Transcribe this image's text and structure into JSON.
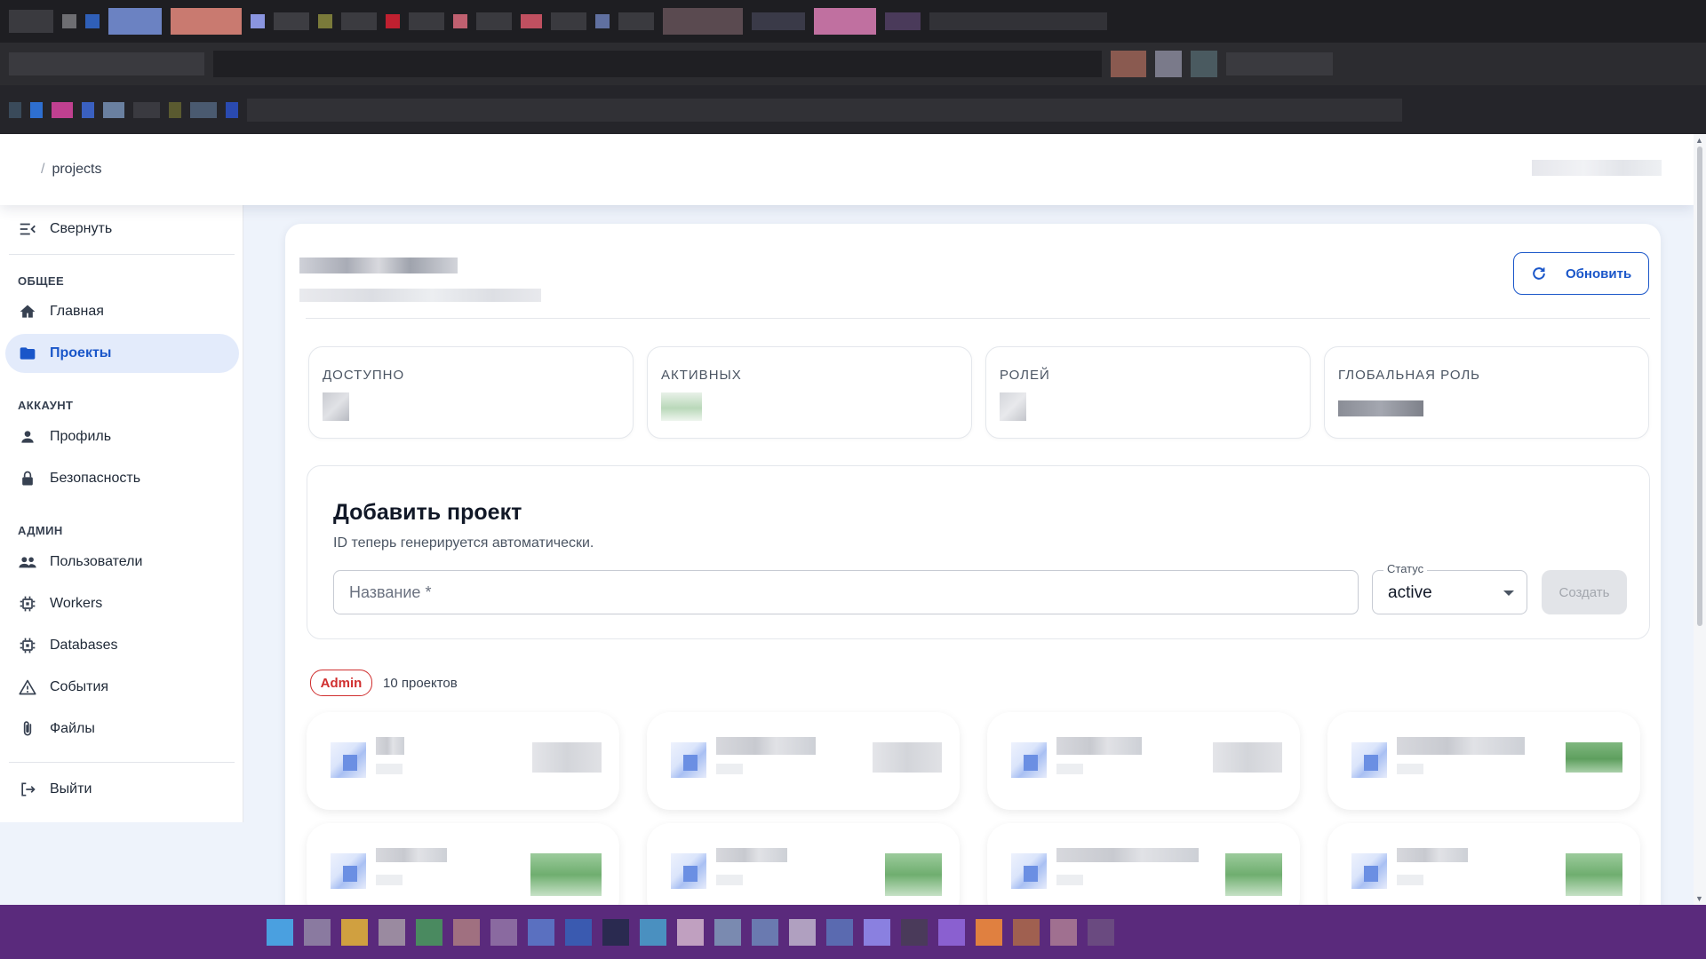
{
  "breadcrumb": {
    "separator": "/",
    "current": "projects"
  },
  "sidebar": {
    "collapse": {
      "label": "Свернуть",
      "icon": "collapse-menu-icon"
    },
    "sections": [
      {
        "title": "ОБЩЕЕ"
      },
      {
        "title": "АККАУНТ"
      },
      {
        "title": "АДМИН"
      }
    ],
    "items": [
      {
        "label": "Главная",
        "icon": "home-icon"
      },
      {
        "label": "Проекты",
        "icon": "folder-icon",
        "active": true
      },
      {
        "label": "Профиль",
        "icon": "person-icon"
      },
      {
        "label": "Безопасность",
        "icon": "lock-icon"
      },
      {
        "label": "Пользователи",
        "icon": "people-icon"
      },
      {
        "label": "Workers",
        "icon": "chip-icon"
      },
      {
        "label": "Databases",
        "icon": "chip-icon"
      },
      {
        "label": "События",
        "icon": "warning-icon"
      },
      {
        "label": "Файлы",
        "icon": "paperclip-icon"
      }
    ],
    "logout": {
      "label": "Выйти",
      "icon": "logout-icon"
    }
  },
  "header": {
    "refresh_label": "Обновить"
  },
  "stats": [
    {
      "label": "ДОСТУПНО"
    },
    {
      "label": "АКТИВНЫХ"
    },
    {
      "label": "РОЛЕЙ"
    },
    {
      "label": "ГЛОБАЛЬНАЯ РОЛЬ"
    }
  ],
  "add_project": {
    "title": "Добавить проект",
    "subtitle": "ID теперь генерируется автоматически.",
    "name_placeholder": "Название *",
    "status_label": "Статус",
    "status_value": "active",
    "create_label": "Создать"
  },
  "projects_header": {
    "role_badge": "Admin",
    "count_text": "10 проектов"
  },
  "colors": {
    "accent": "#1a56c9",
    "active_bg": "#e3ebfb",
    "badge_red": "#d02f2f",
    "taskbar": "#5a2a7c"
  }
}
